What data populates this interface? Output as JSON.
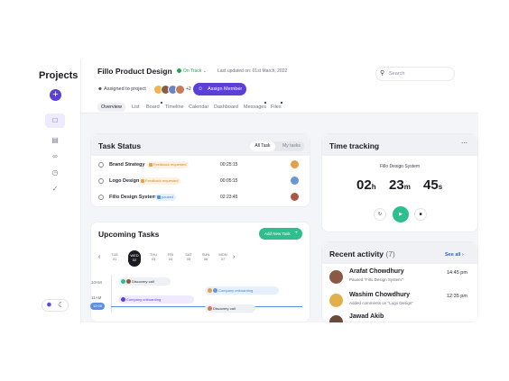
{
  "sidebar": {
    "title": "Projects",
    "add_label": "+",
    "icons": [
      "plus-icon",
      "folder-icon",
      "archive-icon",
      "paperclip-icon",
      "clock-icon",
      "check-circle-icon"
    ],
    "theme_icons": [
      "sun-icon",
      "moon-icon"
    ]
  },
  "header": {
    "title": "Fillo Product Design",
    "status": "On Track",
    "status_color": "#27a35a",
    "updated_label": "Last updated on:",
    "updated_date": "01st March, 2022",
    "search_placeholder": "Search",
    "assigned_label": "Assigned to project",
    "avatars_more": "+2",
    "assign_button": "Assign Member",
    "tabs": [
      "Overview",
      "List",
      "Board",
      "Timeline",
      "Calendar",
      "Dashboard",
      "Messages",
      "Files"
    ]
  },
  "task_status": {
    "title": "Task Status",
    "toggle_all": "All Task",
    "toggle_mine": "My tasks",
    "tasks": [
      {
        "name": "Brand Strategy",
        "badge": "Feedback requested",
        "time": "00:25:15"
      },
      {
        "name": "Logo Design",
        "badge": "Feedback requested",
        "time": "00:05:15"
      },
      {
        "name": "Fillo Design System",
        "badge": "paused",
        "time": "02:23:45"
      }
    ]
  },
  "upcoming": {
    "title": "Upcoming Tasks",
    "add_button": "Add New Task",
    "days": [
      {
        "dow": "TUE",
        "num": "01"
      },
      {
        "dow": "WED",
        "num": "02"
      },
      {
        "dow": "THU",
        "num": "03"
      },
      {
        "dow": "FRI",
        "num": "04"
      },
      {
        "dow": "SAT",
        "num": "05"
      },
      {
        "dow": "SUN",
        "num": "06"
      },
      {
        "dow": "MON",
        "num": "07"
      }
    ],
    "time_labels": [
      "10AM",
      "11AM",
      "12:00"
    ],
    "events": [
      "Discovery call",
      "Company onboarding",
      "Company onboarding",
      "Discovery call"
    ]
  },
  "time_tracking": {
    "title": "Time tracking",
    "more_icon": "more-horizontal-icon",
    "project": "Fillo Design System",
    "hours": "02",
    "hours_unit": "h",
    "minutes": "23",
    "minutes_unit": "m",
    "seconds": "45",
    "seconds_unit": "s"
  },
  "recent_activity": {
    "title": "Recent activity",
    "count": "(7)",
    "see_all": "See all",
    "items": [
      {
        "name": "Arafat Chowdhury",
        "desc": "Paused \"Fillo Design System\"",
        "time": "14:45 pm"
      },
      {
        "name": "Washim Chowdhury",
        "desc": "Added comments on \"Logo Design\"",
        "time": "12:35 pm"
      },
      {
        "name": "Jawad Akib",
        "desc": "",
        "time": ""
      }
    ]
  },
  "colors": {
    "accent": "#5b3fd6",
    "success": "#2fbf8f",
    "link": "#2f5fd6"
  }
}
